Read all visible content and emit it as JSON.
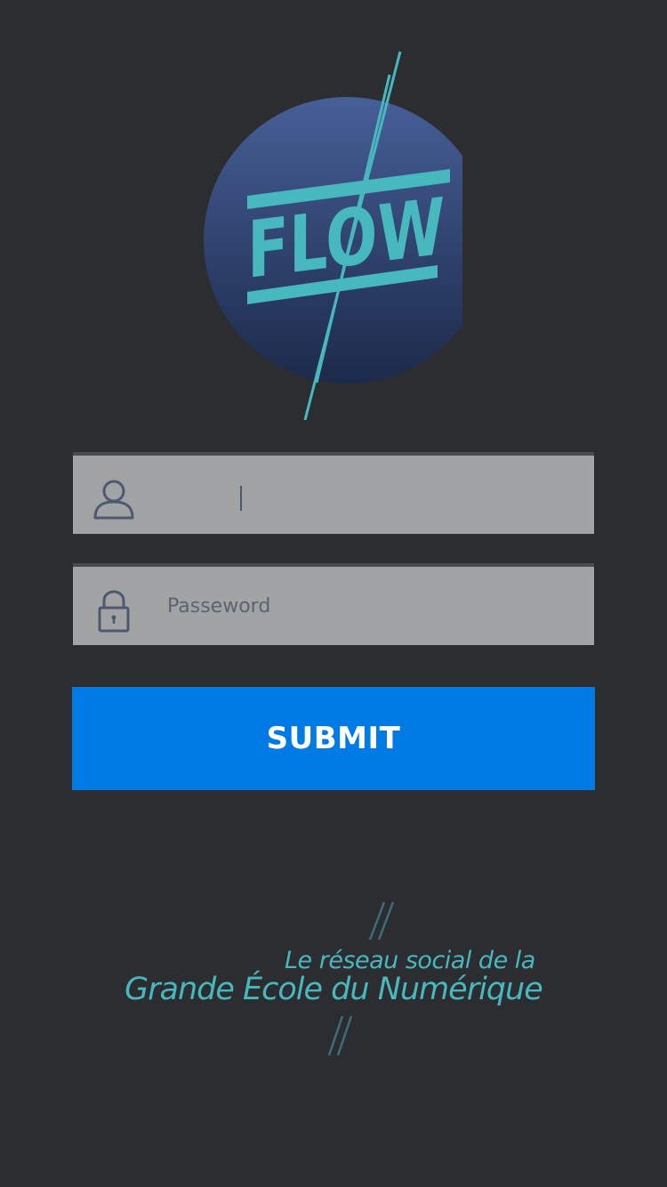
{
  "brand": {
    "logo_text": "FLOW",
    "accent_color": "#48b8bf",
    "circle_color_top": "#465f97",
    "circle_color_bottom": "#1c2a4a"
  },
  "login": {
    "username": {
      "value": "",
      "placeholder": "",
      "icon": "user-icon"
    },
    "password": {
      "value": "",
      "placeholder": "Passeword",
      "icon": "lock-icon"
    },
    "submit_label": "SUBMIT",
    "submit_color": "#007ae5"
  },
  "footer": {
    "tagline_line1": "Le réseau social de la",
    "tagline_line2": "Grande École du Numérique"
  }
}
